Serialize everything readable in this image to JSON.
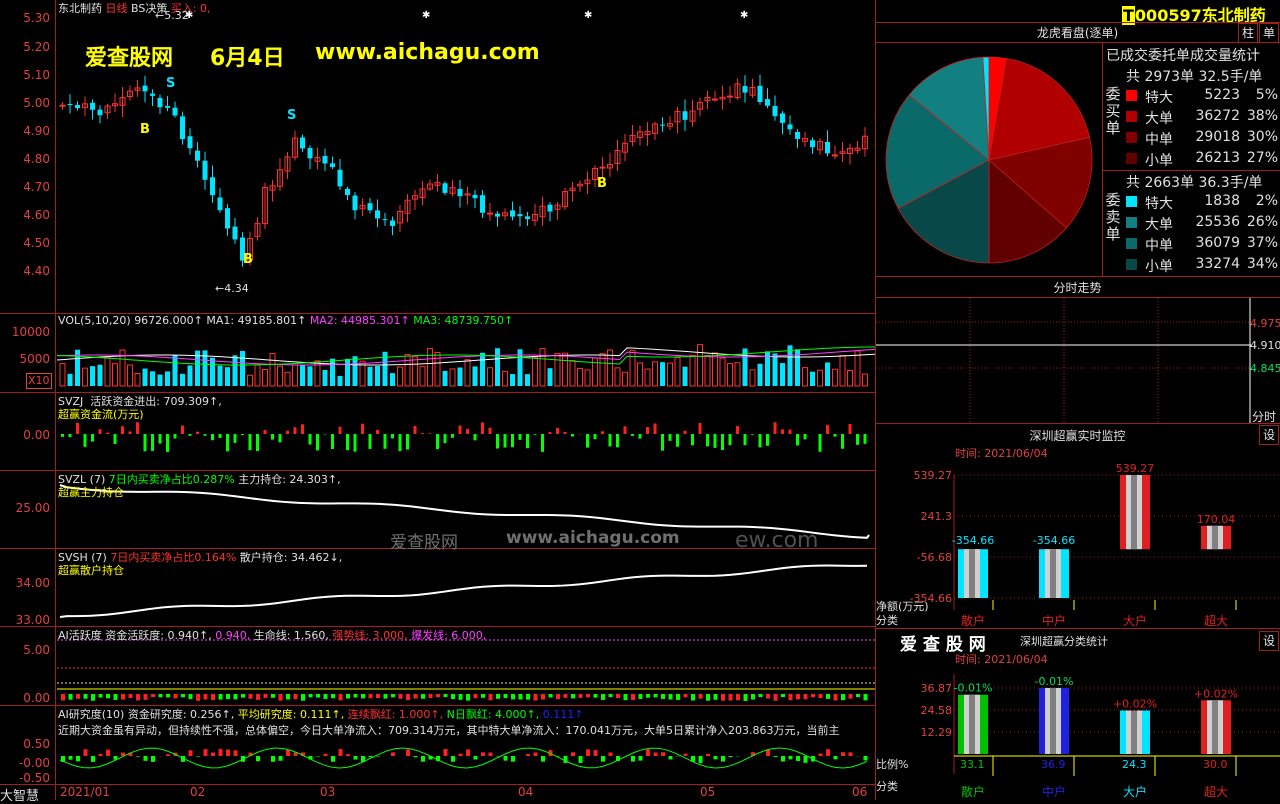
{
  "stock": {
    "badge": "T",
    "code": "000597",
    "name": "东北制药"
  },
  "top_title": {
    "name": "东北制药",
    "period": "日线",
    "indicator": "BS决策",
    "buy_label": "买入: 0,"
  },
  "watermark": {
    "site": "爱查股网",
    "date": "6月4日",
    "url": "www.aichagu.com",
    "ghost_site": "爱查股网",
    "ghost_url": "www.aichagu.com",
    "ghost_tail": "ew.com"
  },
  "price_axis": [
    "5.30",
    "5.20",
    "5.10",
    "5.00",
    "4.90",
    "4.80",
    "4.70",
    "4.60",
    "4.50",
    "4.40"
  ],
  "price_marks": {
    "high": "5.32",
    "low": "4.34",
    "signals": [
      "B",
      "S",
      "S",
      "B",
      "B"
    ]
  },
  "vol_panel": {
    "title": "VOL(5,10,20)",
    "vol": "96726.000↑",
    "ma1": "MA1: 49185.801↑",
    "ma2": "MA2: 44985.301↑",
    "ma3": "MA3: 48739.750↑",
    "axis": [
      "10000",
      "5000"
    ],
    "unit": "X10"
  },
  "svzj": {
    "title": "SVZJ",
    "label": "活跃资金进出: 709.309↑,",
    "sub": "超赢资金流(万元)",
    "axis": [
      "0.00"
    ]
  },
  "svzl": {
    "title": "SVZL (7)",
    "ratio": "7日内买卖净占比0.287%",
    "hold": "主力持仓: 24.303↑,",
    "sub": "超赢主力持仓",
    "axis": [
      "25.00"
    ]
  },
  "svsh": {
    "title": "SVSH (7)",
    "ratio": "7日内买卖净占比0.164%",
    "hold": "散户持仓: 34.462↓,",
    "sub": "超赢散户持仓",
    "axis": [
      "34.00",
      "33.00"
    ]
  },
  "ai_active": {
    "title": "AI活跃度",
    "a": "资金活跃度: 0.940↑,",
    "b": "0.940,",
    "c": "生命线: 1.560,",
    "d": "强势线: 3.000,",
    "e": "爆发线: 6.000,",
    "axis": [
      "5.00",
      "0.00"
    ]
  },
  "ai_research": {
    "title": "AI研究度(10)",
    "a": "资金研究度: 0.256↑,",
    "b": "平均研究度: 0.111↑,",
    "c": "连续飘红: 1.000↑,",
    "d": "N日飘红: 4.000↑,",
    "e": "0.111↑",
    "text": "近期大资金虽有异动，但持续性不强，总体偏空，今日大单净流入：709.314万元，其中特大单净流入：170.041万元，大单5日累计净入203.863万元，当前主",
    "axis": [
      "0.50",
      "-0.00",
      "-0.50"
    ]
  },
  "x_axis": [
    "2021/01",
    "02",
    "03",
    "04",
    "05",
    "06"
  ],
  "brand": "大智慧",
  "dragon": {
    "title": "龙虎看盘(逐单)",
    "subtitle": "已成交委托单成交量统计",
    "buy": {
      "side": "委买单",
      "total": "共 2973单 32.5手/单",
      "rows": [
        [
          "特大",
          "5223",
          "5%"
        ],
        [
          "大单",
          "36272",
          "38%"
        ],
        [
          "中单",
          "29018",
          "30%"
        ],
        [
          "小单",
          "26213",
          "27%"
        ]
      ]
    },
    "sell": {
      "side": "委卖单",
      "total": "共 2663单 36.3手/单",
      "rows": [
        [
          "特大",
          "1838",
          "2%"
        ],
        [
          "大单",
          "25536",
          "26%"
        ],
        [
          "中单",
          "36079",
          "37%"
        ],
        [
          "小单",
          "33274",
          "34%"
        ]
      ]
    },
    "buy_colors": [
      "#ff0000",
      "#b00000",
      "#800000",
      "#600000"
    ],
    "sell_colors": [
      "#00e5ff",
      "#128080",
      "#0a6a6a",
      "#084848"
    ]
  },
  "intraday": {
    "title": "分时走势",
    "prices": [
      "4.975",
      "4.910",
      "4.845"
    ],
    "unit": "分时"
  },
  "monitor": {
    "title": "深圳超赢实时监控",
    "date": "时间: 2021/06/04",
    "set": "设",
    "axis": [
      "539.27",
      "241.3",
      "-56.68",
      "-354.66"
    ],
    "ylab": "净额(万元)",
    "xlab": "分类",
    "bars": [
      {
        "cat": "散户",
        "value": -354.66,
        "label": "-354.66"
      },
      {
        "cat": "中户",
        "value": -354.66,
        "label": "-354.66"
      },
      {
        "cat": "大户",
        "value": 539.27,
        "label": "539.27"
      },
      {
        "cat": "超大",
        "value": 170.04,
        "label": "170.04"
      }
    ]
  },
  "classify": {
    "brand": "爱 查 股 网",
    "title": "深圳超赢分类统计",
    "date": "时间: 2021/06/04",
    "set": "设",
    "axis": [
      "36.87",
      "24.58",
      "12.29"
    ],
    "ylab": "比例%",
    "xlab": "分类",
    "bars": [
      {
        "cat": "散户",
        "value": 33.1,
        "label": "33.1",
        "delta": "-0.01%",
        "color": "#00c000"
      },
      {
        "cat": "中户",
        "value": 36.9,
        "label": "36.9",
        "delta": "-0.01%",
        "color": "#2020e0"
      },
      {
        "cat": "大户",
        "value": 24.3,
        "label": "24.3",
        "delta": "+0.02%",
        "color": "#00e5ff"
      },
      {
        "cat": "超大",
        "value": 30.0,
        "label": "30.0",
        "delta": "+0.02%",
        "color": "#e02020"
      }
    ]
  },
  "side_buttons": {
    "a": "柱",
    "b": "单"
  }
}
